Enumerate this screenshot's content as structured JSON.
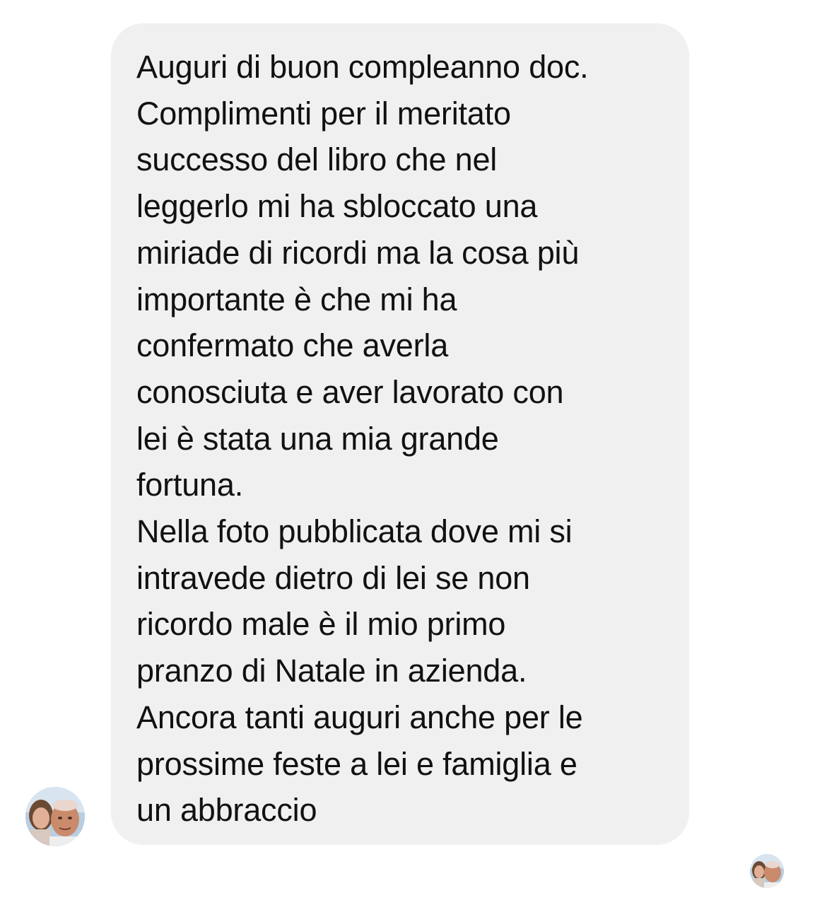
{
  "message": {
    "lines": [
      "Auguri di buon compleanno doc.",
      "Complimenti per il meritato",
      "successo del libro che nel",
      "leggerlo mi ha sbloccato una",
      "miriade di ricordi ma la cosa più",
      "importante è che mi ha",
      "confermato che averla",
      "conosciuta e aver lavorato con",
      "lei è stata una mia grande",
      "fortuna.",
      "Nella foto pubblicata dove mi si",
      "intravede dietro di lei se non",
      "ricordo male è il mio primo",
      "pranzo di Natale in azienda.",
      "Ancora tanti auguri anche per le",
      "prossime feste a lei e famiglia e",
      "un abbraccio"
    ]
  },
  "colors": {
    "bubble": "#f0f0f0",
    "text": "#111111",
    "background": "#ffffff"
  },
  "icons": {
    "sender_avatar": "sender-avatar-photo",
    "read_receipt_avatar": "read-receipt-avatar-photo"
  }
}
